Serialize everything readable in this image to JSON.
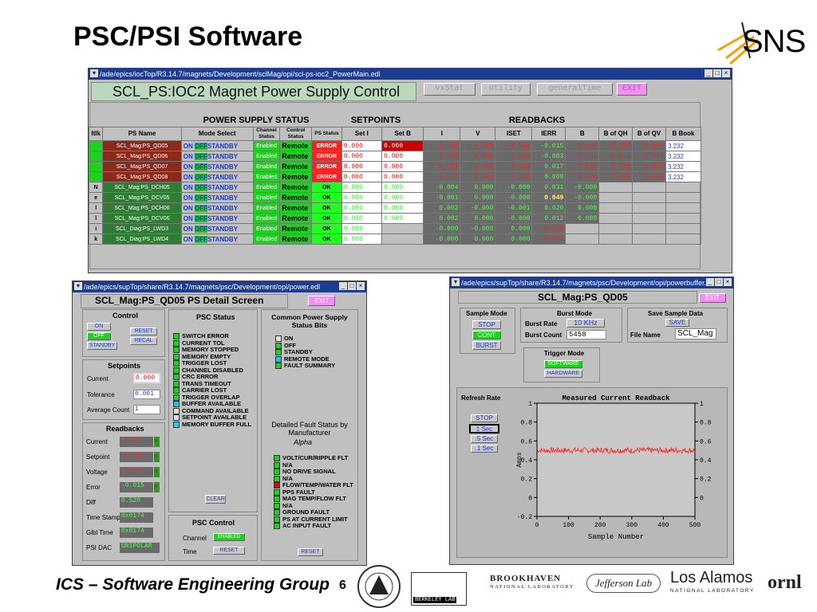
{
  "slide": {
    "title": "PSC/PSI Software",
    "logo_text": "SNS",
    "footer": "ICS – Software Engineering Group",
    "page": "6",
    "sponsors": [
      "BERKELEY LAB",
      "BROOKHAVEN",
      "NATIONAL LABORATORY",
      "Jefferson Lab",
      "Los Alamos",
      "NATIONAL LABORATORY",
      "ornl"
    ]
  },
  "main_window": {
    "title": "/ade/epics/iocTop/R3.14.7/magnets/Development/sclMag/opi/scl-ps-ioc2_PowerMain.edl",
    "header": "SCL_PS:IOC2 Magnet Power Supply Control",
    "top_buttons": [
      "vxStat",
      "Utility",
      "generalTime",
      "EXIT"
    ],
    "sections": {
      "status": "POWER SUPPLY STATUS",
      "setpoints": "SETPOINTS",
      "readbacks": "READBACKS"
    },
    "columns": [
      "Itlk",
      "PS Name",
      "Mode Select",
      "Channel Status",
      "Control Status",
      "PS Status",
      "Set I",
      "Set B",
      "I",
      "V",
      "ISET",
      "IERR",
      "B",
      "B of QH",
      "B of QV",
      "B Book"
    ],
    "itlk_label": "Nellik",
    "mode_labels": {
      "on": "ON",
      "off": "OFF",
      "standby": "STANDBY"
    },
    "rows": [
      {
        "name": "SCL_Mag:PS_QD05",
        "chan": "Enabled",
        "ctrl": "Remote",
        "ps": "ERROR",
        "seti": "0.000",
        "setb": "0.000",
        "i": "0.509",
        "v": "0.063",
        "iset": "-0.755",
        "ierr": "-0.015",
        "b": "0.007",
        "bqh": "0.007",
        "bqv": "0.007",
        "bbook": "3.232"
      },
      {
        "name": "SCL_Mag:PS_QD06",
        "chan": "Enabled",
        "ctrl": "Remote",
        "ps": "ERROR",
        "seti": "0.000",
        "setb": "0.000",
        "i": "0.958",
        "v": "0.044",
        "iset": "-0.428",
        "ierr": "-0.003",
        "b": "0.011",
        "bqh": "0.011",
        "bqv": "0.011",
        "bbook": "3.232"
      },
      {
        "name": "SCL_Mag:PS_QD07",
        "chan": "Enabled",
        "ctrl": "Remote",
        "ps": "ERROR",
        "seti": "0.000",
        "setb": "0.000",
        "i": "0.781",
        "v": "0.052",
        "iset": "0.628",
        "ierr": "0.017",
        "b": "0.010",
        "bqh": "0.010",
        "bqv": "0.010",
        "bbook": "3.232"
      },
      {
        "name": "SCL_Mag:PS_QD08",
        "chan": "Enabled",
        "ctrl": "Remote",
        "ps": "ERROR",
        "seti": "0.000",
        "setb": "0.000",
        "i": "-0.017",
        "v": "0.024",
        "iset": "0.207",
        "ierr": "0.009",
        "b": "0.000",
        "bqh": "0.000",
        "bqv": "0.000",
        "bbook": "3.232"
      },
      {
        "name": "SCL_Mag:PS_DCH05",
        "chan": "Enabled",
        "ctrl": "Remote",
        "ps": "OK",
        "seti": "0.000",
        "setb": "0.000",
        "i": "-0.004",
        "v": "0.000",
        "iset": "-0.000",
        "ierr": "0.031",
        "b": "-0.000",
        "bqh": "",
        "bqv": "",
        "bbook": ""
      },
      {
        "name": "SCL_Mag:PS_DCV05",
        "chan": "Enabled",
        "ctrl": "Remote",
        "ps": "OK",
        "seti": "0.000",
        "setb": "0.000",
        "i": "-0.001",
        "v": "0.000",
        "iset": "-0.000",
        "ierr": "0.049",
        "b": "-0.000",
        "bqh": "",
        "bqv": "",
        "bbook": ""
      },
      {
        "name": "SCL_Mag:PS_DCH06",
        "chan": "Enabled",
        "ctrl": "Remote",
        "ps": "OK",
        "seti": "0.000",
        "setb": "0.000",
        "i": "0.002",
        "v": "-0.000",
        "iset": "-0.001",
        "ierr": "0.020",
        "b": "0.000",
        "bqh": "",
        "bqv": "",
        "bbook": ""
      },
      {
        "name": "SCL_Mag:PS_DCV06",
        "chan": "Enabled",
        "ctrl": "Remote",
        "ps": "OK",
        "seti": "0.000",
        "setb": "0.000",
        "i": "0.002",
        "v": "0.000",
        "iset": "-0.000",
        "ierr": "0.012",
        "b": "0.000",
        "bqh": "",
        "bqv": "",
        "bbook": ""
      },
      {
        "name": "SCL_Diag:PS_LWD3",
        "chan": "Enabled",
        "ctrl": "Remote",
        "ps": "OK",
        "seti": "0.000",
        "setb": "",
        "i": "-0.000",
        "v": "-0.000",
        "iset": "0.000",
        "ierr": "-0.053",
        "b": "",
        "bqh": "",
        "bqv": "",
        "bbook": ""
      },
      {
        "name": "SCL_Diag:PS_LWD4",
        "chan": "Enabled",
        "ctrl": "Remote",
        "ps": "OK",
        "seti": "0.000",
        "setb": "",
        "i": "-0.000",
        "v": "0.000",
        "iset": "0.000",
        "ierr": "0.053",
        "b": "",
        "bqh": "",
        "bqv": "",
        "bbook": ""
      }
    ]
  },
  "detail_window": {
    "title": "/ade/epics/supTop/share/R3.14.7/magnets/psc/Development/opi/power.edl",
    "header": "SCL_Mag:PS_QD05 PS Detail Screen",
    "exit": "EXIT",
    "control": {
      "title": "Control",
      "on": "ON",
      "off": "OFF",
      "standby": "STANDBY",
      "reset": "RESET",
      "recal": "RECAL"
    },
    "setpoints": {
      "title": "Setpoints",
      "current_label": "Current",
      "current": "0.000",
      "tolerance_label": "Tolerance",
      "tolerance": "0.001",
      "avg_label": "Average Count",
      "avg": "1"
    },
    "readbacks": {
      "title": "Readbacks",
      "rows": [
        {
          "label": "Current",
          "value": "0.509"
        },
        {
          "label": "Setpoint",
          "value": "-0.755"
        },
        {
          "label": "Voltage",
          "value": "0.063"
        },
        {
          "label": "Error",
          "value": "-0.015"
        },
        {
          "label": "Diff",
          "value": "0.528"
        },
        {
          "label": "Time Stamp",
          "value": "0x0174"
        },
        {
          "label": "Glbl Time",
          "value": "0x0174"
        },
        {
          "label": "PSI DAC",
          "value": "UNIPOLAR"
        }
      ]
    },
    "psc_status": {
      "title": "PSC Status",
      "items": [
        "SWITCH ERROR",
        "CURRENT TOL",
        "MEMORY STOPPED",
        "MEMORY EMPTY",
        "TRIGGER LOST",
        "CHANNEL DISABLED",
        "CRC ERROR",
        "TRANS TIMEOUT",
        "CARRIER LOST",
        "TRIGGER OVERLAP",
        "BUFFER AVAILABLE",
        "COMMAND AVAILABLE",
        "SETPOINT AVAILABLE",
        "MEMORY BUFFER FULL"
      ],
      "clear": "CLEAR"
    },
    "common_status": {
      "title": "Common Power Supply Status Bits",
      "items": [
        "ON",
        "OFF",
        "STANDBY",
        "REMOTE MODE",
        "FAULT SUMMARY"
      ]
    },
    "fault_status": {
      "title": "Detailed Fault Status by Manufacturer",
      "maker": "Alpha",
      "items": [
        "VOLT/CUR/RIPPLE FLT",
        "N/A",
        "NO DRIVE SIGNAL",
        "N/A",
        "FLOW/TEMP/WATER FLT",
        "PPS FAULT",
        "MAG TEMP/FLOW FLT",
        "N/A",
        "GROUND FAULT",
        "PS AT CURRENT LIMIT",
        "AC INPUT FAULT"
      ],
      "reset": "RESET"
    },
    "psc_control": {
      "title": "PSC Control",
      "channel_label": "Channel",
      "channel": "ENABLED",
      "time_label": "Time",
      "reset": "RESET"
    }
  },
  "buffer_window": {
    "title": "/ade/epics/supTop/share/R3.14.7/magnets/psc/Development/opi/powerbuffer.e",
    "header": "SCL_Mag:PS_QD05",
    "exit": "EXIT",
    "sample_mode": {
      "title": "Sample Mode",
      "stop": "STOP",
      "cont": "CONT",
      "burst": "BURST"
    },
    "burst_mode": {
      "title": "Burst Mode",
      "rate_label": "Burst Rate",
      "rate": "10 KHz",
      "count_label": "Burst Count",
      "count": "5458"
    },
    "save": {
      "title": "Save Sample Data",
      "save": "SAVE",
      "file_label": "File Name",
      "file": "SCL_Mag"
    },
    "trigger": {
      "title": "Trigger Mode",
      "software": "SOFTWARE",
      "hardware": "HARDWARE"
    },
    "refresh": {
      "title": "Refresh Rate",
      "options": [
        "STOP",
        "1 Sec",
        ".5 Sec",
        ".1 Sec"
      ]
    }
  },
  "chart_data": {
    "type": "line",
    "title": "Measured Current Readback",
    "xlabel": "Sample Number",
    "ylabel": "Amps",
    "xlim": [
      0,
      500
    ],
    "ylim": [
      -0.2,
      1
    ],
    "xticks": [
      "0",
      "100",
      "200",
      "300",
      "400",
      "500"
    ],
    "yticks_left": [
      "1",
      "0.8",
      "0.6",
      "0.4",
      "0.2",
      "0",
      "-0.2"
    ],
    "yticks_right": [
      "1",
      "0.8",
      "0.6",
      "0.4",
      "0.2",
      "0"
    ],
    "series": [
      {
        "color": "#ff2020",
        "mean": 0.5,
        "noise": 0.03
      }
    ]
  }
}
